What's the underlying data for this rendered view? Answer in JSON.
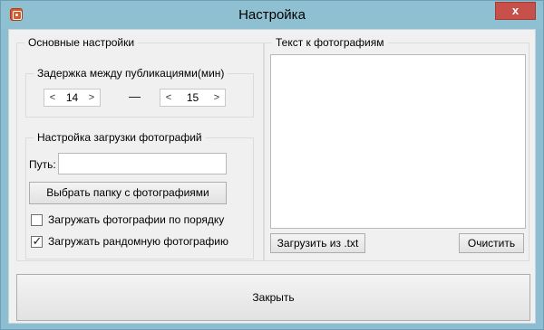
{
  "window": {
    "title": "Настройка",
    "close_glyph": "x"
  },
  "basic_settings": {
    "legend": "Основные настройки",
    "delay": {
      "legend": "Задержка между публикациями(мин)",
      "from_value": "14",
      "separator": "—",
      "to_value": "15",
      "arrow_left": "<",
      "arrow_right": ">"
    },
    "upload": {
      "legend": "Настройка загрузки фотографий",
      "path_label": "Путь:",
      "path_value": "",
      "choose_folder_label": "Выбрать папку с фотографиями",
      "checkbox_order_label": "Загружать фотографии по порядку",
      "checkbox_order_checked": false,
      "checkbox_random_label": "Загружать рандомную фотографию",
      "checkbox_random_checked": true
    }
  },
  "text_panel": {
    "legend": "Текст к фотографиям",
    "text_value": "",
    "load_button_label": "Загрузить из .txt",
    "clear_button_label": "Очистить"
  },
  "footer": {
    "close_button_label": "Закрыть"
  },
  "colors": {
    "titlebar": "#8fc0d2",
    "close_button": "#c7504a",
    "client_bg": "#f0f0f0"
  },
  "icons": {
    "app": "instagram-icon",
    "check": "checkmark-icon"
  }
}
